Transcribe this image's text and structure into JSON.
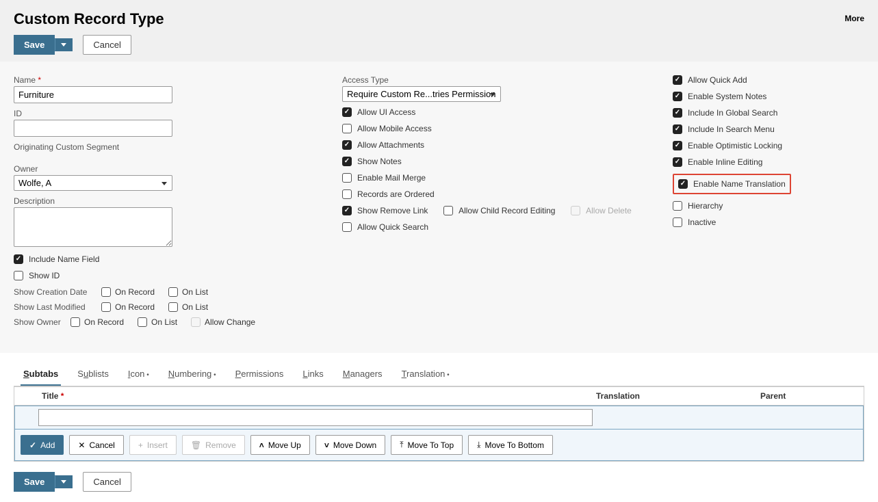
{
  "header": {
    "title": "Custom Record Type",
    "more": "More",
    "save": "Save",
    "cancel": "Cancel"
  },
  "fields": {
    "name_label": "Name",
    "name_value": "Furniture",
    "id_label": "ID",
    "id_value": "",
    "ocs_label": "Originating Custom Segment",
    "owner_label": "Owner",
    "owner_value": "Wolfe, A",
    "desc_label": "Description",
    "desc_value": "",
    "include_name_field": "Include Name Field",
    "show_id": "Show ID",
    "show_creation_date": "Show Creation Date",
    "show_last_modified": "Show Last Modified",
    "show_owner": "Show Owner",
    "on_record": "On Record",
    "on_list": "On List",
    "allow_change": "Allow Change"
  },
  "col2": {
    "access_type_label": "Access Type",
    "access_type_value": "Require Custom Re...tries Permission",
    "allow_ui_access": "Allow UI Access",
    "allow_mobile_access": "Allow Mobile Access",
    "allow_attachments": "Allow Attachments",
    "show_notes": "Show Notes",
    "enable_mail_merge": "Enable Mail Merge",
    "records_ordered": "Records are Ordered",
    "show_remove_link": "Show Remove Link",
    "allow_child_edit": "Allow Child Record Editing",
    "allow_delete": "Allow Delete",
    "allow_quick_search": "Allow Quick Search"
  },
  "col3": {
    "allow_quick_add": "Allow Quick Add",
    "enable_system_notes": "Enable System Notes",
    "include_global_search": "Include In Global Search",
    "include_search_menu": "Include In Search Menu",
    "enable_optimistic_locking": "Enable Optimistic Locking",
    "enable_inline_editing": "Enable Inline Editing",
    "enable_name_translation": "Enable Name Translation",
    "hierarchy": "Hierarchy",
    "inactive": "Inactive"
  },
  "tabs": {
    "subtabs": "Subtabs",
    "sublists": "Sublists",
    "icon": "Icon",
    "numbering": "Numbering",
    "permissions": "Permissions",
    "links": "Links",
    "managers": "Managers",
    "translation": "Translation"
  },
  "table": {
    "col_title": "Title",
    "col_translation": "Translation",
    "col_parent": "Parent",
    "add": "Add",
    "cancel": "Cancel",
    "insert": "Insert",
    "remove": "Remove",
    "move_up": "Move Up",
    "move_down": "Move Down",
    "move_top": "Move To Top",
    "move_bottom": "Move To Bottom"
  }
}
